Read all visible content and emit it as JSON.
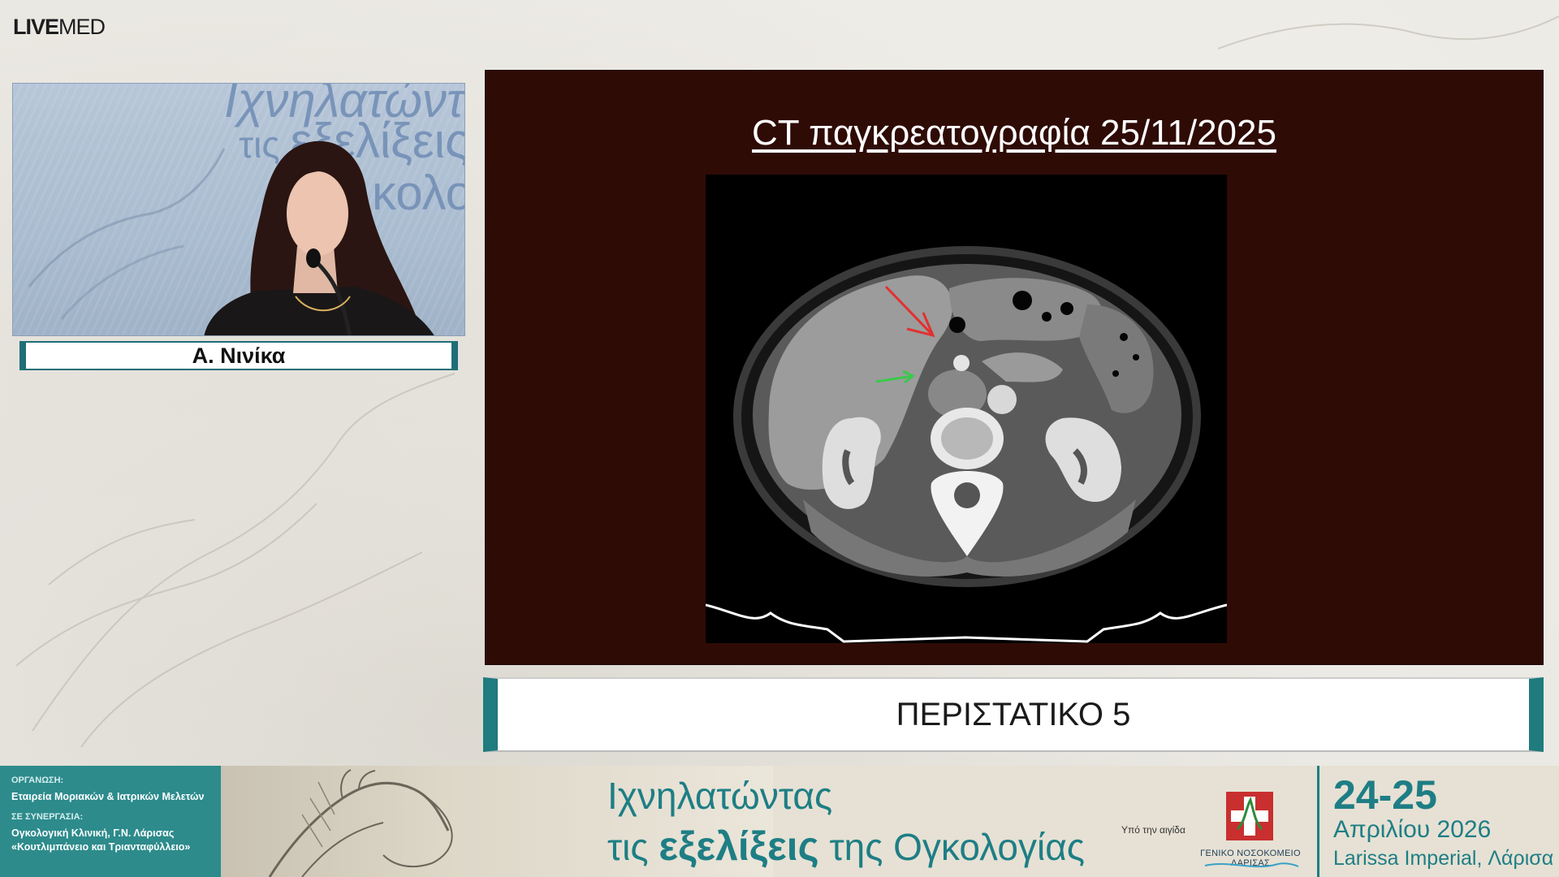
{
  "logo": {
    "bold": "LIVE",
    "light": "MED"
  },
  "speaker": {
    "name": "Α. Νινίκα",
    "backdrop_line1": "Ιχνηλατώντ",
    "backdrop_line2_prefix": "τις ",
    "backdrop_line2_word": "εξελίξεις",
    "backdrop_line3": "κολογ"
  },
  "slide": {
    "title": "CT παγκρεατογραφία 25/11/2025",
    "background": "#2f0b06"
  },
  "case_banner": "ΠΕΡΙΣΤΑΤΙΚΟ 5",
  "footer": {
    "org_label": "ΟΡΓΑΝΩΣΗ:",
    "org_name": "Εταιρεία Μοριακών & Ιατρικών Μελετών",
    "collab_label": "ΣΕ ΣΥΝΕΡΓΑΣΙΑ:",
    "collab_line1": "Ογκολογική Κλινική, Γ.Ν. Λάρισας",
    "collab_line2": "«Κουτλιμπάνειο και Τριανταφύλλειο»",
    "title_line1": "Ιχνηλατώντας",
    "title_line2_a": "τις ",
    "title_line2_b": "εξελίξεις",
    "title_line2_c": " της ",
    "title_line2_d": "Ογκολογίας",
    "patronage": "Υπό την αιγίδα",
    "hospital": "ΓΕΝΙΚΟ ΝΟΣΟΚΟΜΕΙΟ ΛΑΡΙΣΑΣ",
    "dates": "24-25",
    "month_year": "Απριλίου 2026",
    "venue": "Larissa Imperial, Λάρισα",
    "accent": "#1e7e85"
  }
}
